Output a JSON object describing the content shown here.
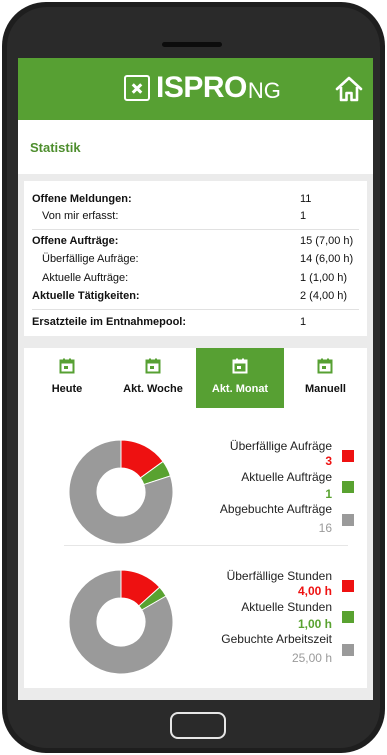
{
  "app": {
    "logo_main": "ISPRO",
    "logo_suffix": "NG"
  },
  "page": {
    "title": "Statistik"
  },
  "stats": [
    {
      "label": "Offene Meldungen:",
      "value": "11",
      "bold": true
    },
    {
      "label": "Von mir erfasst:",
      "value": "1",
      "bold": false
    },
    {
      "label": "Offene Aufträge:",
      "value": "15  (7,00 h)",
      "bold": true
    },
    {
      "label": "Überfällige Aufräge:",
      "value": "14  (6,00 h)",
      "bold": false
    },
    {
      "label": "Aktuelle Aufträge:",
      "value": "1    (1,00 h)",
      "bold": false
    },
    {
      "label": "Aktuelle Tätigkeiten:",
      "value": "2    (4,00 h)",
      "bold": true
    },
    {
      "label": "Ersatzteile im Entnahmepool:",
      "value": "1",
      "bold": true
    }
  ],
  "tabs": [
    {
      "label": "Heute",
      "icon": "calendar-icon",
      "active": false
    },
    {
      "label": "Akt. Woche",
      "icon": "calendar-icon",
      "active": false
    },
    {
      "label": "Akt. Monat",
      "icon": "calendar-icon",
      "active": true
    },
    {
      "label": "Manuell",
      "icon": "calendar-icon",
      "active": false
    }
  ],
  "colors": {
    "accent": "#57a033",
    "overdue": "#ee1111",
    "current": "#59a230",
    "booked": "#9a9a9a"
  },
  "charts": {
    "orders": {
      "items": [
        {
          "name": "Überfällige Aufräge",
          "value": "3",
          "amount": 3,
          "color": "#ee1111"
        },
        {
          "name": "Aktuelle Aufträge",
          "value": "1",
          "amount": 1,
          "color": "#59a230"
        },
        {
          "name": "Abgebuchte Aufträge",
          "value": "16",
          "amount": 16,
          "color": "#9a9a9a"
        }
      ]
    },
    "hours": {
      "items": [
        {
          "name": "Überfällige Stunden",
          "value": "4,00 h",
          "amount": 4,
          "color": "#ee1111"
        },
        {
          "name": "Aktuelle Stunden",
          "value": "1,00 h",
          "amount": 1,
          "color": "#59a230"
        },
        {
          "name": "Gebuchte Arbeitszeit",
          "value": "25,00 h",
          "amount": 25,
          "color": "#9a9a9a"
        }
      ]
    }
  }
}
